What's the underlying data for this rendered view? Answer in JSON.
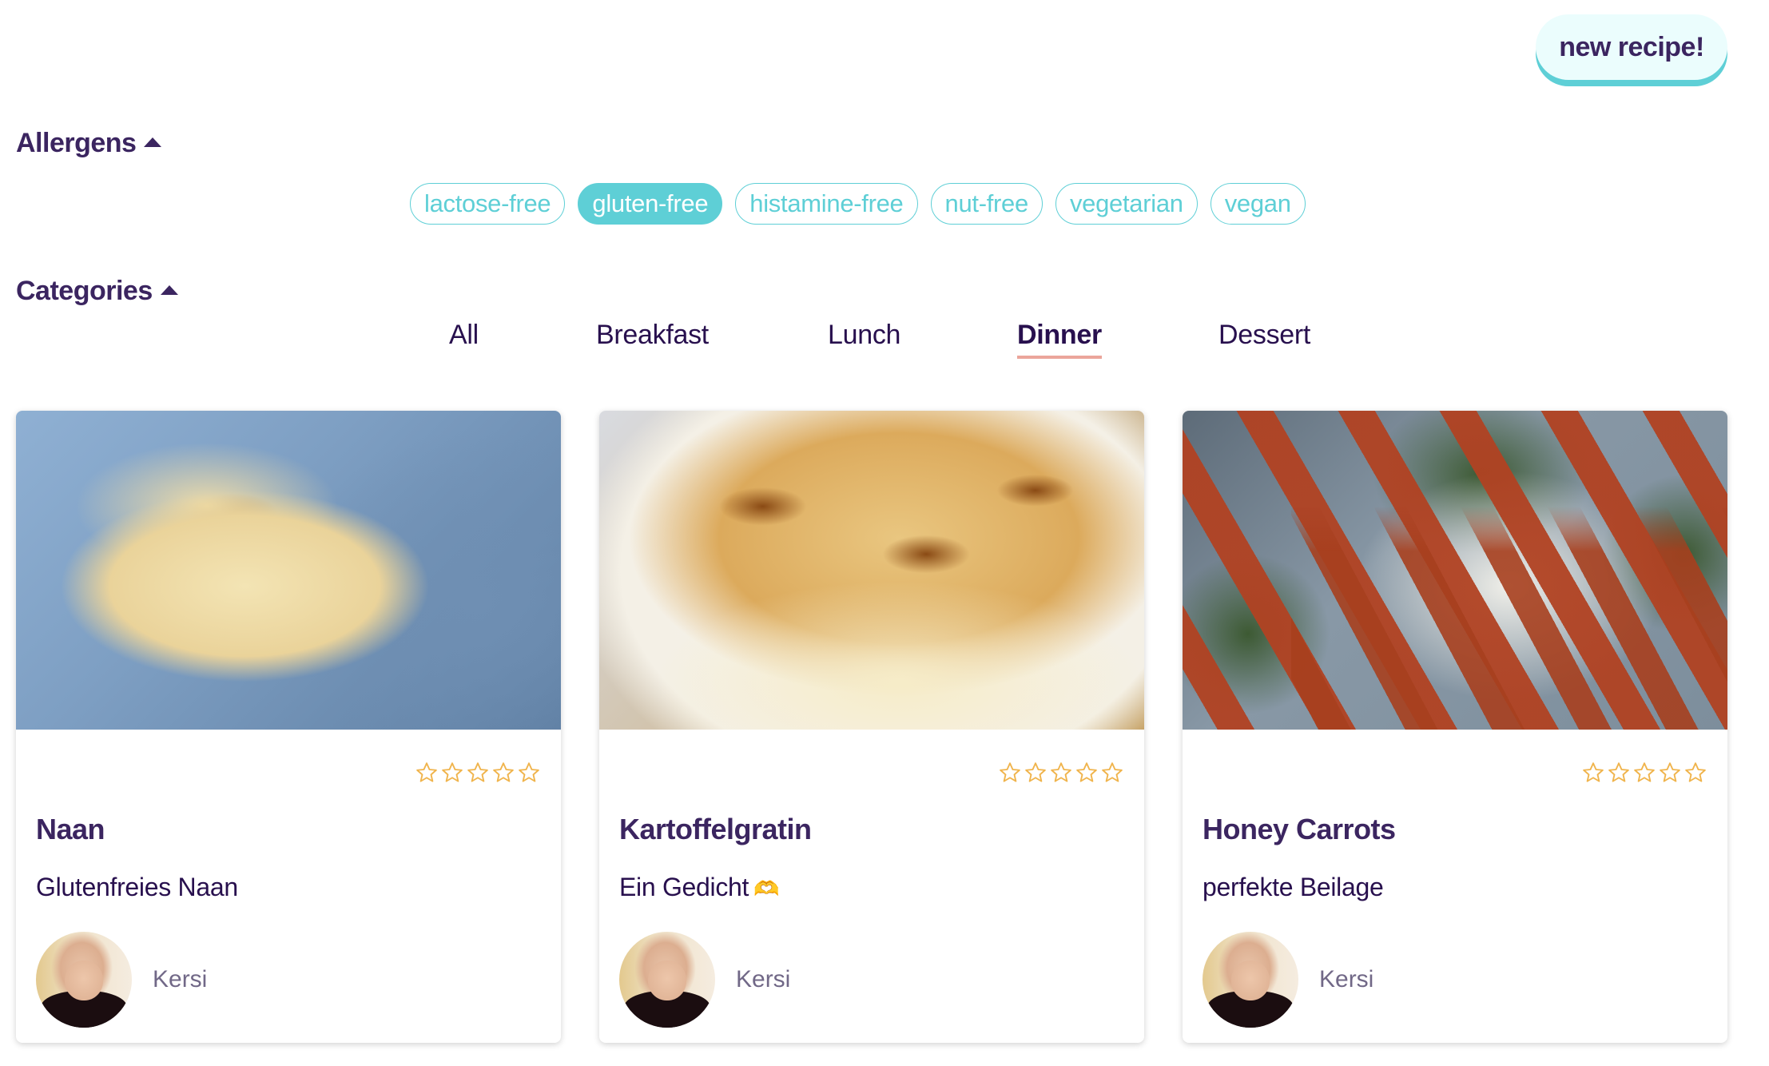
{
  "header": {
    "new_recipe_label": "new recipe!"
  },
  "allergens": {
    "title": "Allergens",
    "toggle_icon": "caret-up-icon",
    "chips": [
      {
        "label": "lactose-free",
        "active": false
      },
      {
        "label": "gluten-free",
        "active": true
      },
      {
        "label": "histamine-free",
        "active": false
      },
      {
        "label": "nut-free",
        "active": false
      },
      {
        "label": "vegetarian",
        "active": false
      },
      {
        "label": "vegan",
        "active": false
      }
    ]
  },
  "categories": {
    "title": "Categories",
    "toggle_icon": "caret-up-icon",
    "tabs": [
      {
        "label": "All",
        "active": false
      },
      {
        "label": "Breakfast",
        "active": false
      },
      {
        "label": "Lunch",
        "active": false
      },
      {
        "label": "Dinner",
        "active": true
      },
      {
        "label": "Dessert",
        "active": false
      }
    ]
  },
  "recipes": [
    {
      "title": "Naan",
      "subtitle": "Glutenfreies Naan",
      "subtitle_emoji": "",
      "image": "naan-photo",
      "rating": 0,
      "rating_max": 5,
      "author": "Kersi"
    },
    {
      "title": "Kartoffelgratin",
      "subtitle": "Ein Gedicht",
      "subtitle_emoji": "🫶",
      "image": "gratin-photo",
      "rating": 0,
      "rating_max": 5,
      "author": "Kersi"
    },
    {
      "title": "Honey Carrots",
      "subtitle": "perfekte Beilage",
      "subtitle_emoji": "",
      "image": "carrots-photo",
      "rating": 0,
      "rating_max": 5,
      "author": "Kersi"
    }
  ],
  "colors": {
    "primary_text": "#3b2560",
    "accent_teal": "#5ecfd6",
    "button_bg": "#ebfdfd",
    "tab_underline": "#eba59b",
    "star": "#f0b44c",
    "author_text": "#716887"
  }
}
